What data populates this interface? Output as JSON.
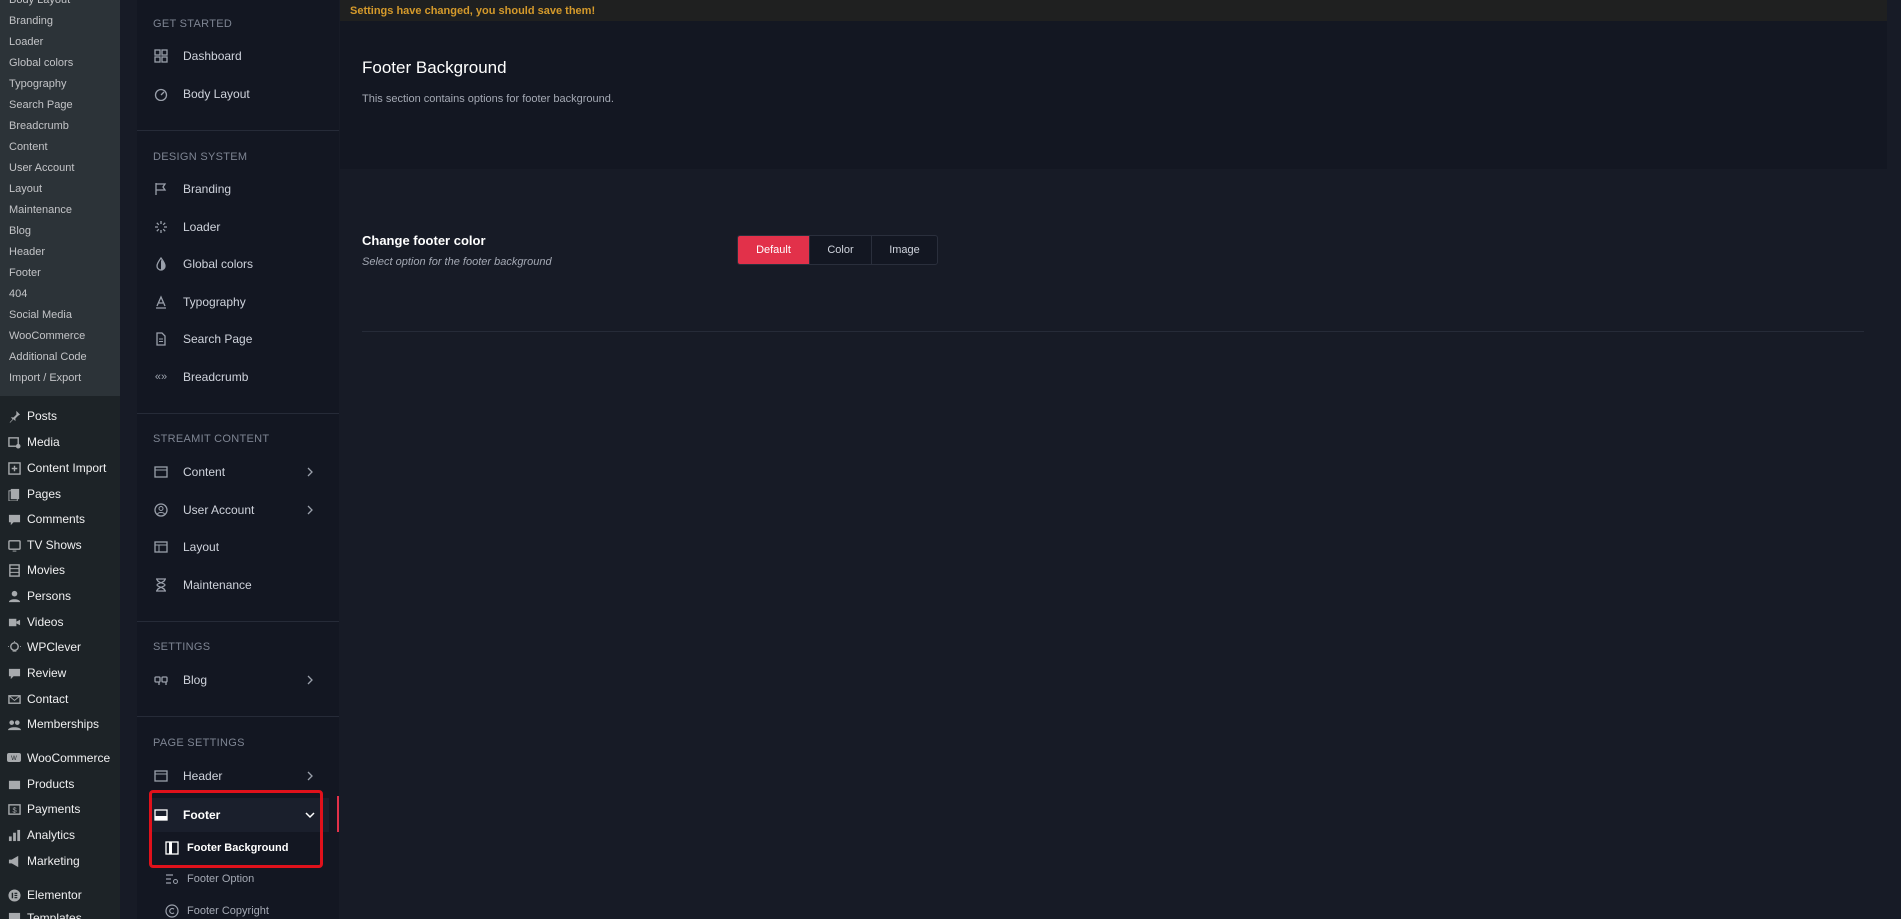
{
  "wp_submenu": [
    "Branding",
    "Loader",
    "Global colors",
    "Typography",
    "Search Page",
    "Breadcrumb",
    "Content",
    "User Account",
    "Layout",
    "Maintenance",
    "Blog",
    "Header",
    "Footer",
    "404",
    "Social Media",
    "WooCommerce",
    "Additional Code",
    "Import / Export"
  ],
  "wp_menu": [
    {
      "label": "Posts",
      "icon": "pin-icon"
    },
    {
      "label": "Media",
      "icon": "media-icon"
    },
    {
      "label": "Content Import",
      "icon": "import-icon"
    },
    {
      "label": "Pages",
      "icon": "pages-icon"
    },
    {
      "label": "Comments",
      "icon": "comments-icon"
    },
    {
      "label": "TV Shows",
      "icon": "tv-icon"
    },
    {
      "label": "Movies",
      "icon": "film-icon"
    },
    {
      "label": "Persons",
      "icon": "person-icon"
    },
    {
      "label": "Videos",
      "icon": "video-icon"
    },
    {
      "label": "WPClever",
      "icon": "lightbulb-icon"
    },
    {
      "label": "Review",
      "icon": "review-icon"
    },
    {
      "label": "Contact",
      "icon": "mail-icon"
    },
    {
      "label": "Memberships",
      "icon": "group-icon"
    },
    {
      "label": "WooCommerce",
      "icon": "woo-icon"
    },
    {
      "label": "Products",
      "icon": "products-icon"
    },
    {
      "label": "Payments",
      "icon": "payments-icon"
    },
    {
      "label": "Analytics",
      "icon": "analytics-icon"
    },
    {
      "label": "Marketing",
      "icon": "megaphone-icon"
    },
    {
      "label": "Elementor",
      "icon": "elementor-icon"
    },
    {
      "label": "Templates",
      "icon": "templates-icon"
    }
  ],
  "sidebar": {
    "sections": {
      "get_started": "GET STARTED",
      "design_system": "DESIGN SYSTEM",
      "streamit_content": "STREAMIT CONTENT",
      "settings": "SETTINGS",
      "page_settings": "PAGE SETTINGS"
    },
    "items": {
      "dashboard": "Dashboard",
      "body_layout": "Body Layout",
      "branding": "Branding",
      "loader": "Loader",
      "global_colors": "Global colors",
      "typography": "Typography",
      "search_page": "Search Page",
      "breadcrumb": "Breadcrumb",
      "content": "Content",
      "user_account": "User Account",
      "layout": "Layout",
      "maintenance": "Maintenance",
      "blog": "Blog",
      "header": "Header",
      "footer": "Footer"
    },
    "footer_sub": {
      "background": "Footer Background",
      "option": "Footer Option",
      "copyright": "Footer Copyright"
    },
    "breadcrumb_glyph": "«»"
  },
  "main": {
    "notice": "Settings have changed, you should save them!",
    "page_title": "Footer Background",
    "page_desc": "This section contains options for footer background.",
    "option_title": "Change footer color",
    "option_desc": "Select option for the footer background",
    "buttons": {
      "default": "Default",
      "color": "Color",
      "image": "Image"
    },
    "selected": "Default"
  },
  "colors": {
    "accent": "#e2314a",
    "notice": "#d59a2b",
    "highlight": "#e0111b"
  }
}
